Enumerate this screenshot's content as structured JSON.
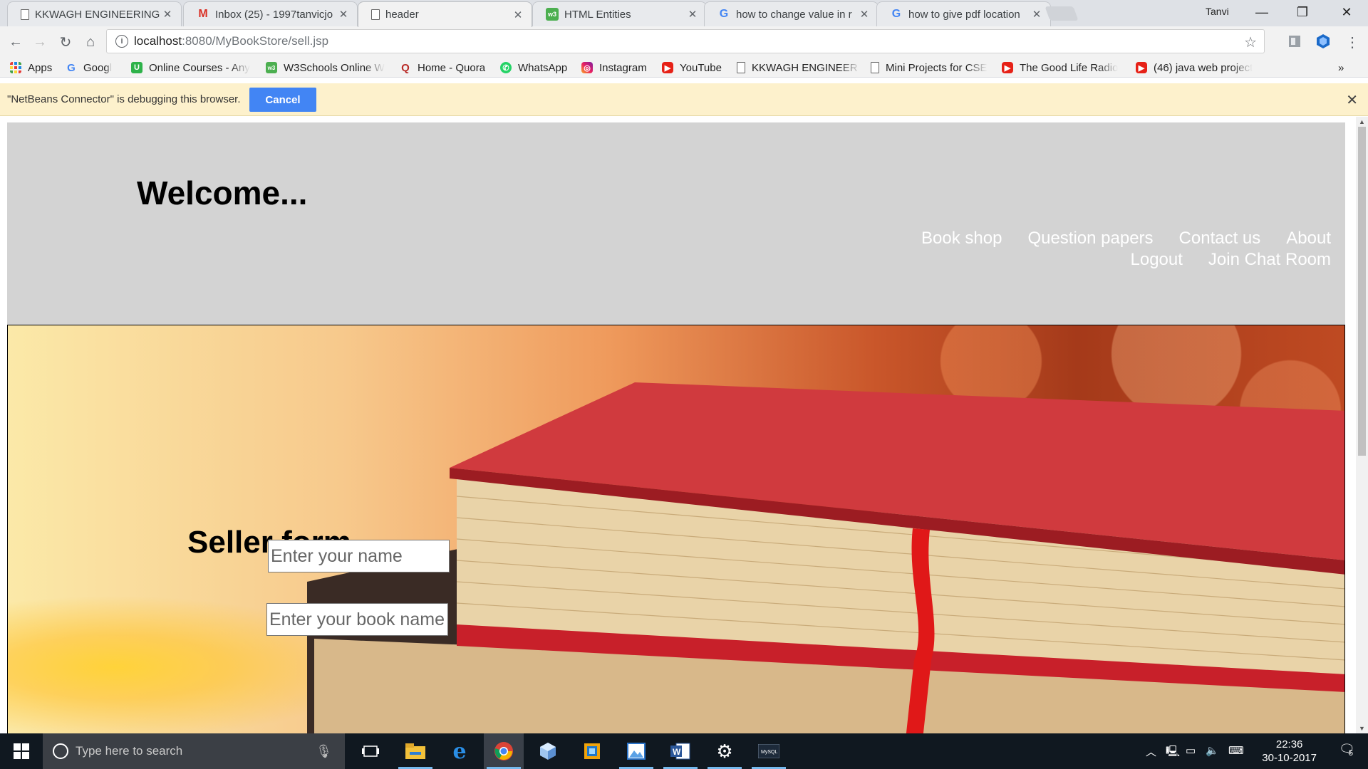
{
  "browser": {
    "tabs": [
      {
        "title": "KKWAGH ENGINEERING",
        "icon": "page-icon",
        "active": false
      },
      {
        "title": "Inbox (25) - 1997tanvicjo",
        "icon": "gmail-icon",
        "active": false
      },
      {
        "title": "header",
        "icon": "page-icon",
        "active": true
      },
      {
        "title": "HTML Entities",
        "icon": "w3schools-icon",
        "active": false
      },
      {
        "title": "how to change value in r",
        "icon": "google-icon",
        "active": false
      },
      {
        "title": "how to give pdf location",
        "icon": "google-icon",
        "active": false
      }
    ],
    "profile_name": "Tanvi",
    "url_host": "localhost",
    "url_path": ":8080/MyBookStore/sell.jsp",
    "bookmarks": [
      {
        "label": "Apps",
        "icon": "apps-grid-icon"
      },
      {
        "label": "Googl",
        "icon": "google-icon"
      },
      {
        "label": "Online Courses - Any",
        "icon": "udemy-icon"
      },
      {
        "label": "W3Schools Online W",
        "icon": "w3schools-icon"
      },
      {
        "label": "Home - Quora",
        "icon": "quora-icon"
      },
      {
        "label": "WhatsApp",
        "icon": "whatsapp-icon"
      },
      {
        "label": "Instagram",
        "icon": "instagram-icon"
      },
      {
        "label": "YouTube",
        "icon": "youtube-icon"
      },
      {
        "label": "KKWAGH ENGINEERI",
        "icon": "page-icon"
      },
      {
        "label": "Mini Projects for CSE",
        "icon": "page-icon"
      },
      {
        "label": "The Good Life Radio",
        "icon": "youtube-icon"
      },
      {
        "label": "(46) java web project",
        "icon": "youtube-icon"
      }
    ],
    "more_bookmarks": "»",
    "infobar_text": "\"NetBeans Connector\" is debugging this browser.",
    "infobar_cancel": "Cancel"
  },
  "page": {
    "welcome": "Welcome...",
    "nav_links": [
      "Book shop",
      "Question papers",
      "Contact us",
      "About",
      "Logout",
      "Join Chat Room"
    ],
    "form_title": "Seller form",
    "name_placeholder": "Enter your name",
    "book_placeholder": "Enter your book name"
  },
  "taskbar": {
    "search_placeholder": "Type here to search",
    "time": "22:36",
    "date": "30-10-2017",
    "notification_count": "5",
    "apps": [
      "task-view-icon",
      "file-explorer-icon",
      "edge-icon",
      "chrome-icon",
      "virtualbox-icon",
      "app-icon",
      "photos-icon",
      "word-icon",
      "settings-icon",
      "mysql-icon"
    ]
  },
  "colors": {
    "header_bg": "#d3d3d3",
    "nav_link": "#ffffff",
    "accent": "#4285f4",
    "infobar_bg": "#fdf1cc",
    "taskbar_bg": "#101820"
  }
}
